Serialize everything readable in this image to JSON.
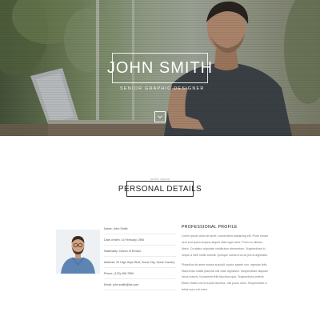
{
  "hero": {
    "name": "JOHN SMITH",
    "subtitle": "SENIOR GRAPHIC DESIGNER"
  },
  "about": {
    "section_label": "lorem ipsum",
    "section_title": "PERSONAL DETAILS"
  },
  "details": [
    {
      "text": "Name: John Smith"
    },
    {
      "text": "Date of birth: 14 February 1996"
    },
    {
      "text": "Nationality: Citizen of Ernsko"
    },
    {
      "text": "Address: 23 High Hope Blvd, Some City, Some Country"
    },
    {
      "text": "Phone: (123)-456-7890"
    },
    {
      "text": "Email: john.smith@lbs.com"
    }
  ],
  "profile": {
    "heading": "PROFESSIONAL PROFILE",
    "paragraphs": [
      "Lorem ipsum dolor sit amet, consectetur adipiscing elit. Proin ornare sem sed quam tempus aliquet vitae eget dolor. Proin eu ultrices libero. Curabitur vulputate vestibulum elementum. Suspendisse id neque a nibh mollis blandit. Quisque varius eros ac purus dignissim.",
      "Phasellus sit amet massa suscipit, auctor sapien non, egestas felis. Maecenas mattis placerat nisl vitae dignissim. Suspendisse aliquam lacus mauris, id placerat felis faucibus quis. Suspendisse potenti. Etiam mattis orci et turpis faucibus, nisl purus dolor. Suspendisse a tellus nunc vel enim."
    ]
  }
}
